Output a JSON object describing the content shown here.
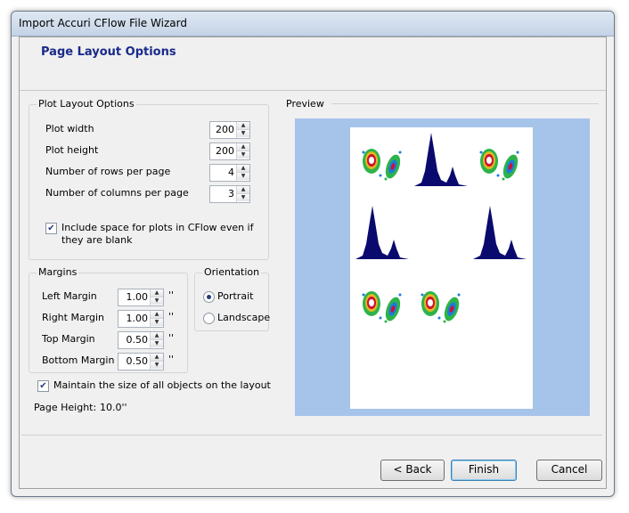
{
  "window": {
    "title": "Import Accuri CFlow File Wizard"
  },
  "header": {
    "title": "Page Layout Options"
  },
  "plot_layout": {
    "group_label": "Plot Layout Options",
    "fields": [
      {
        "label": "Plot width",
        "value": "200"
      },
      {
        "label": "Plot height",
        "value": "200"
      },
      {
        "label": "Number of rows per page",
        "value": "4"
      },
      {
        "label": "Number of columns per page",
        "value": "3"
      }
    ],
    "include_blank": {
      "checked": true,
      "label_line1": "Include space for plots in CFlow even if",
      "label_line2": "they are blank"
    }
  },
  "margins": {
    "group_label": "Margins",
    "unit": "''",
    "fields": [
      {
        "label": "Left Margin",
        "value": "1.00"
      },
      {
        "label": "Right Margin",
        "value": "1.00"
      },
      {
        "label": "Top Margin",
        "value": "0.50"
      },
      {
        "label": "Bottom Margin",
        "value": "0.50"
      }
    ]
  },
  "orientation": {
    "group_label": "Orientation",
    "options": [
      {
        "label": "Portrait",
        "selected": true
      },
      {
        "label": "Landscape",
        "selected": false
      }
    ]
  },
  "maintain_size": {
    "checked": true,
    "label": "Maintain the size of all objects on the layout"
  },
  "page_height": {
    "label": "Page Height:",
    "value": "10.0''"
  },
  "preview": {
    "label": "Preview"
  },
  "buttons": {
    "back": "< Back",
    "finish": "Finish",
    "cancel": "Cancel"
  },
  "colors": {
    "histogram": "#0a0a6e",
    "preview_bg": "#a6c3ea",
    "title_text": "#1a2a8a"
  }
}
